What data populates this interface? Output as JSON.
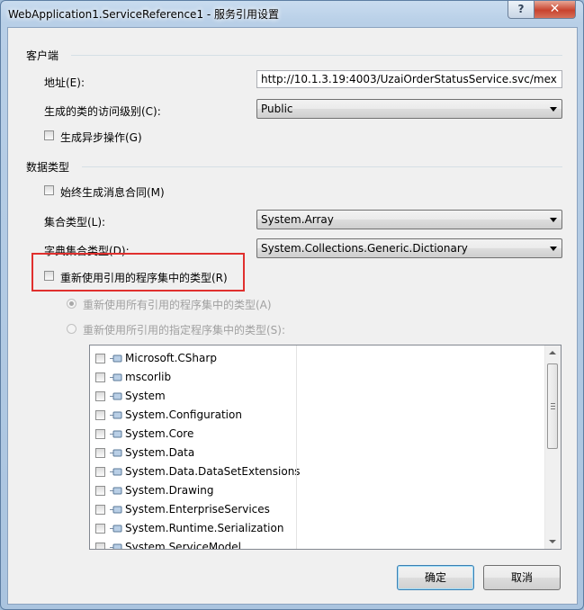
{
  "window": {
    "title": "WebApplication1.ServiceReference1 - 服务引用设置",
    "help_glyph": "?",
    "close_glyph": "✕"
  },
  "client_group": {
    "heading": "客户端",
    "address_label": "地址(E):",
    "address_value": "http://10.1.3.19:4003/UzaiOrderStatusService.svc/mex",
    "access_label": "生成的类的访问级别(C):",
    "access_value": "Public",
    "async_label": "生成异步操作(G)"
  },
  "datatype_group": {
    "heading": "数据类型",
    "always_contracts_label": "始终生成消息合同(M)",
    "collection_label": "集合类型(L):",
    "collection_value": "System.Array",
    "dictionary_label": "字典集合类型(D):",
    "dictionary_value": "System.Collections.Generic.Dictionary",
    "reuse_label": "重新使用引用的程序集中的类型(R)",
    "reuse_all_label": "重新使用所有引用的程序集中的类型(A)",
    "reuse_specified_label": "重新使用所引用的指定程序集中的类型(S):"
  },
  "assemblies": [
    {
      "name": "Microsoft.CSharp"
    },
    {
      "name": "mscorlib"
    },
    {
      "name": "System"
    },
    {
      "name": "System.Configuration"
    },
    {
      "name": "System.Core"
    },
    {
      "name": "System.Data"
    },
    {
      "name": "System.Data.DataSetExtensions"
    },
    {
      "name": "System.Drawing"
    },
    {
      "name": "System.EnterpriseServices"
    },
    {
      "name": "System.Runtime.Serialization"
    },
    {
      "name": "System.ServiceModel"
    }
  ],
  "buttons": {
    "ok": "确定",
    "cancel": "取消"
  },
  "colors": {
    "highlight_box": "#e0302e",
    "title_bar": "#b8cfe7"
  }
}
